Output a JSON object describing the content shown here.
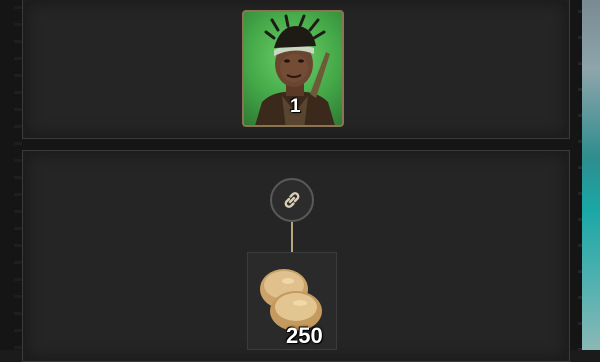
{
  "reward": {
    "character_card": {
      "icon": "character-portrait-icon",
      "quantity": "1"
    },
    "link_icon": "chain-link-icon",
    "item_card": {
      "icon": "bread-rolls-icon",
      "quantity": "250"
    }
  },
  "colors": {
    "background": "#151515",
    "panel": "#252525",
    "card_border": "#8c7452",
    "portrait_bg": "#44a848",
    "connector": "#b8a47c"
  }
}
